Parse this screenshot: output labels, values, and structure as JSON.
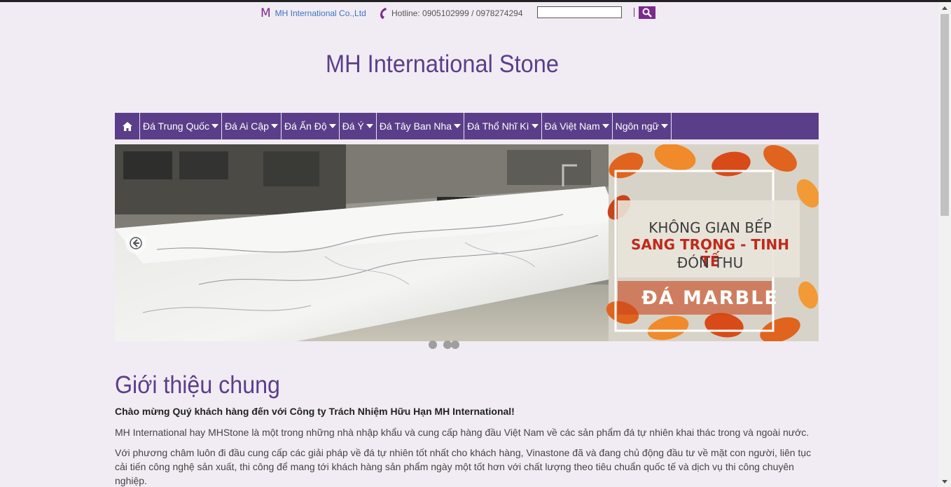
{
  "topbar": {
    "company_name": "MH International Co.,Ltd",
    "company_icon_glyph": "M",
    "hotline": "Hotline: 0905102999 / 0978274294",
    "search_value": ""
  },
  "header": {
    "title": "MH International Stone"
  },
  "nav": {
    "items": [
      {
        "label": "Đá Trung Quốc"
      },
      {
        "label": "Đá Ai Cập"
      },
      {
        "label": "Đá Ấn Độ"
      },
      {
        "label": "Đá Ý"
      },
      {
        "label": "Đá Tây Ban Nha"
      },
      {
        "label": "Đá Thổ Nhĩ Kì"
      },
      {
        "label": "Đá Việt Nam"
      },
      {
        "label": "Ngôn ngữ"
      }
    ]
  },
  "slider": {
    "line1": "KHÔNG GIAN BẾP",
    "line2": "SANG TRỌNG - TINH TẾ",
    "line3": "ĐÓN THU",
    "line4": "ĐÁ MARBLE",
    "slide_count": 3
  },
  "content": {
    "section_title": "Giới thiệu chung",
    "welcome": "Chào mừng Quý khách hàng đến với Công ty Trách Nhiệm Hữu Hạn MH International!",
    "para1": "MH International hay MHStone là một trong những nhà nhập khẩu và cung cấp hàng đầu Việt Nam về các sản phẩm đá tự nhiên khai thác trong và ngoài nước.",
    "para2": "Với phương châm luôn đi đầu cung cấp các giải pháp về đá tự nhiên tốt nhất cho khách hàng, Vinastone đã và đang chủ động đầu tư về mặt con người, liên tục cải tiến công nghệ sản xuất, thi công để mang tới khách hàng sản phẩm ngày một tốt hơn với chất lượng theo tiêu chuẩn quốc tế và dịch vụ thi công chuyên nghiệp."
  },
  "colors": {
    "brand_purple": "#5b3e8a",
    "accent_purple": "#7b2a8f",
    "page_bg": "#f1ecf4",
    "link_blue": "#3a73c4"
  }
}
